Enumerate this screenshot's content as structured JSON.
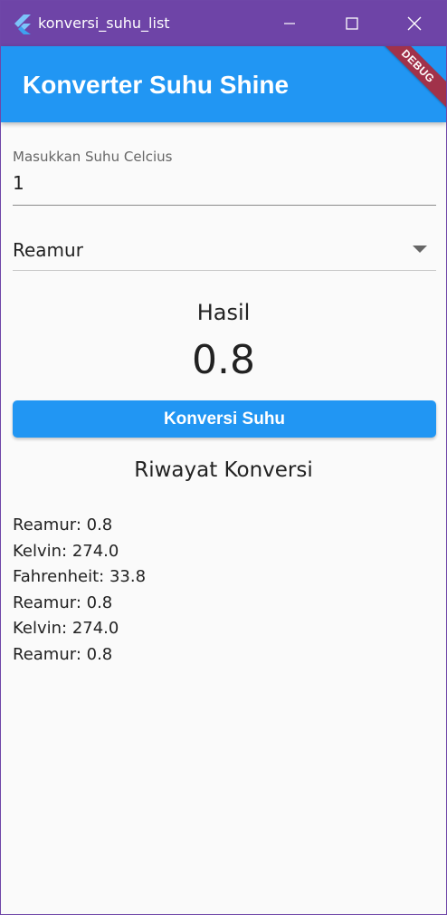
{
  "window": {
    "title": "konversi_suhu_list",
    "icons": {
      "app": "flutter-logo-icon",
      "minimize": "minimize-icon",
      "maximize": "maximize-icon",
      "close": "close-icon"
    }
  },
  "appbar": {
    "title": "Konverter Suhu Shine",
    "debug_banner": "DEBUG"
  },
  "form": {
    "celsius_label": "Masukkan Suhu Celcius",
    "celsius_value": "1",
    "unit_selected": "Reamur",
    "unit_dropdown_icon": "dropdown-arrow-icon"
  },
  "result": {
    "label": "Hasil",
    "value": "0.8"
  },
  "convert_button": {
    "label": "Konversi Suhu"
  },
  "history": {
    "title": "Riwayat Konversi",
    "items": [
      "Reamur: 0.8",
      "Kelvin: 274.0",
      "Fahrenheit: 33.8",
      "Reamur: 0.8",
      "Kelvin: 274.0",
      "Reamur: 0.8"
    ]
  },
  "colors": {
    "titlebar": "#6e44a7",
    "primary": "#2196f3",
    "debug_banner": "#a1324a",
    "background": "#fafafa"
  }
}
